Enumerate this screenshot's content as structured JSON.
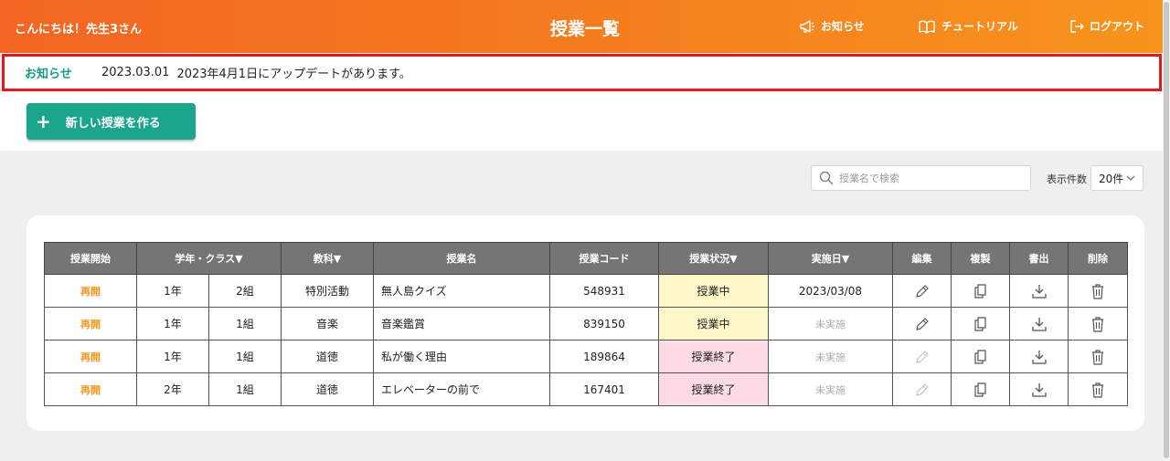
{
  "header": {
    "greeting": "こんにちは！先生3さん",
    "title": "授業一覧",
    "nav": [
      {
        "label": "お知らせ",
        "icon": "megaphone-icon"
      },
      {
        "label": "チュートリアル",
        "icon": "book-icon"
      },
      {
        "label": "ログアウト",
        "icon": "logout-icon"
      }
    ]
  },
  "notice": {
    "label": "お知らせ",
    "date": "2023.03.01",
    "text": "2023年4月1日にアップデートがあります。"
  },
  "new_button": {
    "label": "新しい授業を作る",
    "icon": "plus-icon"
  },
  "search": {
    "placeholder": "授業名で検索",
    "value": "",
    "icon": "search-icon"
  },
  "display_count": {
    "label": "表示件数",
    "value": "20件"
  },
  "table": {
    "headers": {
      "start": "授業開始",
      "grade_class": "学年・クラス▼",
      "subject": "教科▼",
      "name": "授業名",
      "code": "授業コード",
      "status": "授業状況▼",
      "date": "実施日▼",
      "edit": "編集",
      "copy": "複製",
      "export": "書出",
      "delete": "削除"
    },
    "rows": [
      {
        "start": "再開",
        "grade": "1年",
        "class": "2組",
        "subject": "特別活動",
        "name": "無人島クイズ",
        "code": "548931",
        "status": "授業中",
        "date": "2023/03/08",
        "edit_enabled": true
      },
      {
        "start": "再開",
        "grade": "1年",
        "class": "1組",
        "subject": "音楽",
        "name": "音楽鑑賞",
        "code": "839150",
        "status": "授業中",
        "date": "未実施",
        "edit_enabled": true
      },
      {
        "start": "再開",
        "grade": "1年",
        "class": "1組",
        "subject": "道徳",
        "name": "私が働く理由",
        "code": "189864",
        "status": "授業終了",
        "date": "未実施",
        "edit_enabled": false
      },
      {
        "start": "再開",
        "grade": "2年",
        "class": "1組",
        "subject": "道徳",
        "name": "エレベーターの前で",
        "code": "167401",
        "status": "授業終了",
        "date": "未実施",
        "edit_enabled": false
      }
    ]
  },
  "colors": {
    "header_start": "#f26522",
    "header_end": "#f7941d",
    "accent_green": "#1aa58c",
    "notice_border": "#e0191e",
    "status_active": "#fdf6c9",
    "status_done": "#fcdbe6",
    "resume": "#f7941d"
  }
}
